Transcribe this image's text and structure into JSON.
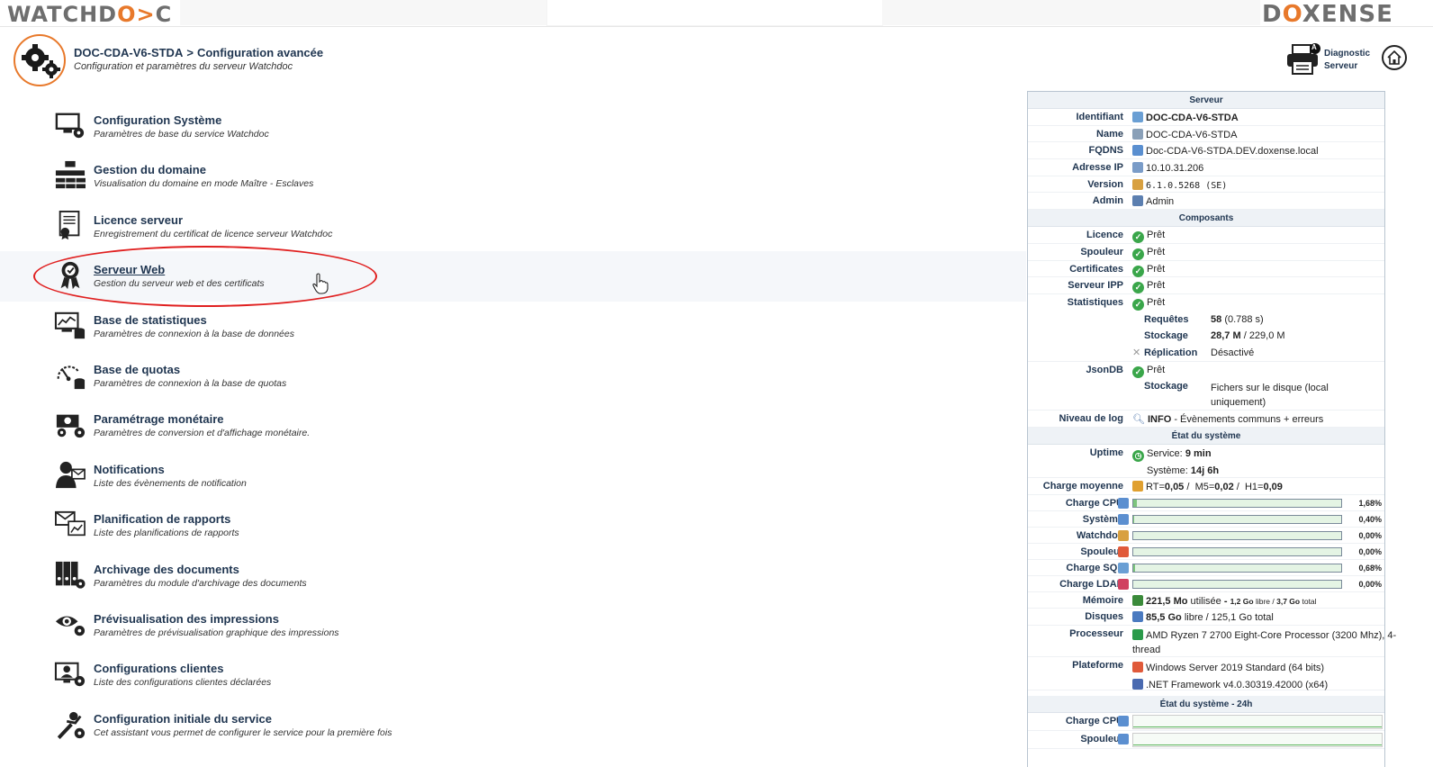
{
  "brand": {
    "left_prefix": "WATCHD",
    "left_mid": "O",
    "left_mid2": "C",
    "right_prefix": "D",
    "right_mid": "O",
    "right_suffix": "XENSE"
  },
  "header": {
    "server_name": "DOC-CDA-V6-STDA",
    "separator": ">",
    "page_title": "Configuration avancée",
    "subtitle": "Configuration et paramètres du serveur Watchdoc",
    "diag_line1": "Diagnostic",
    "diag_line2": "Serveur",
    "diag_badge": "A"
  },
  "menu": [
    {
      "title": "Configuration Système",
      "desc": "Paramètres de base du service Watchdoc",
      "icon": "monitor-gear-icon"
    },
    {
      "title": "Gestion du domaine",
      "desc": "Visualisation du domaine en mode Maître - Esclaves",
      "icon": "domain-servers-icon"
    },
    {
      "title": "Licence serveur",
      "desc": "Enregistrement du certificat de licence serveur Watchdoc",
      "icon": "certificate-icon"
    },
    {
      "title": "Serveur Web",
      "desc": "Gestion du serveur web et des certificats",
      "icon": "award-ribbon-icon"
    },
    {
      "title": "Base de statistiques",
      "desc": "Paramètres de connexion à la base de données",
      "icon": "stats-database-icon"
    },
    {
      "title": "Base de quotas",
      "desc": "Paramètres de connexion à la base de quotas",
      "icon": "quota-gauge-icon"
    },
    {
      "title": "Paramétrage monétaire",
      "desc": "Paramètres de conversion et d'affichage monétaire.",
      "icon": "money-gear-icon"
    },
    {
      "title": "Notifications",
      "desc": "Liste des évènements de notification",
      "icon": "user-mail-icon"
    },
    {
      "title": "Planification de rapports",
      "desc": "Liste des planifications de rapports",
      "icon": "mail-chart-icon"
    },
    {
      "title": "Archivage des documents",
      "desc": "Paramètres du module d'archivage des documents",
      "icon": "archive-binders-icon"
    },
    {
      "title": "Prévisualisation des impressions",
      "desc": "Paramètres de prévisualisation graphique des impressions",
      "icon": "eye-gear-icon"
    },
    {
      "title": "Configurations clientes",
      "desc": "Liste des configurations clientes déclarées",
      "icon": "client-config-icon"
    },
    {
      "title": "Configuration initiale du service",
      "desc": "Cet assistant vous permet de configurer le service pour la première fois",
      "icon": "wizard-icon"
    }
  ],
  "panel": {
    "sec_server": "Serveur",
    "server": [
      {
        "k": "Identifiant",
        "v": "DOC-CDA-V6-STDA",
        "bold": true,
        "c": "#6a9fd4"
      },
      {
        "k": "Name",
        "v": "DOC-CDA-V6-STDA",
        "bold": false,
        "c": "#8aa0b8"
      },
      {
        "k": "FQDNS",
        "v": "Doc-CDA-V6-STDA.DEV.doxense.local",
        "bold": false,
        "c": "#5a8fd0"
      },
      {
        "k": "Adresse IP",
        "v": "10.10.31.206",
        "bold": false,
        "c": "#7a9cc8"
      },
      {
        "k": "Version",
        "v": "6.1.0.5268 (SE)",
        "bold": false,
        "c": "#d8a040"
      },
      {
        "k": "Admin",
        "v": "Admin",
        "bold": false,
        "c": "#5c7fb0"
      }
    ],
    "sec_components": "Composants",
    "ready": "Prêt",
    "components": [
      "Licence",
      "Spouleur",
      "Certificates",
      "Serveur IPP",
      "Statistiques"
    ],
    "stats": {
      "req_label": "Requêtes",
      "req_value": "58",
      "req_extra": "(0.788 s)",
      "sto_label": "Stockage",
      "sto_value": "28,7 M",
      "sto_extra": "/ 229,0 M",
      "rep_label": "Réplication",
      "rep_value": "Désactivé"
    },
    "jsondb": {
      "k": "JsonDB",
      "sto_label": "Stockage",
      "sto_line1": "Fichers sur le disque (local",
      "sto_line2": "uniquement)"
    },
    "log": {
      "k": "Niveau de log",
      "level": "INFO",
      "desc": "- Évènements communs + erreurs"
    },
    "sec_state": "État du système",
    "uptime": {
      "k": "Uptime",
      "svc_label": "Service:",
      "svc_value": "9 min",
      "sys_label": "Système:",
      "sys_value": "14j 6h"
    },
    "load": {
      "k": "Charge moyenne",
      "rt_label": "RT=",
      "rt": "0,05",
      "m5_label": "M5=",
      "m5": "0,02",
      "h1_label": "H1=",
      "h1": "0,09",
      "slash": "/"
    },
    "bars": [
      {
        "k": "Charge CPU",
        "pct": "1,68%",
        "frac": 0.0168,
        "c": "#5b8fd0"
      },
      {
        "k": "Système",
        "pct": "0,40%",
        "frac": 0.004,
        "c": "#5b8fd0"
      },
      {
        "k": "Watchdoc",
        "pct": "0,00%",
        "frac": 0.0,
        "c": "#d8a040"
      },
      {
        "k": "Spouleur",
        "pct": "0,00%",
        "frac": 0.0,
        "c": "#e05a3a"
      },
      {
        "k": "Charge SQL",
        "pct": "0,68%",
        "frac": 0.0068,
        "c": "#6a9fd4"
      },
      {
        "k": "Charge LDAP",
        "pct": "0,00%",
        "frac": 0.0,
        "c": "#d04060"
      }
    ],
    "memory": {
      "k": "Mémoire",
      "used": "221,5 Mo",
      "used_lbl": "utilisée",
      "dash": "-",
      "free": "1,2 Go",
      "free_lbl": "libre",
      "total": "3,7 Go",
      "total_lbl": "total",
      "slash": "/"
    },
    "disks": {
      "k": "Disques",
      "free": "85,5 Go",
      "rest": "libre / 125,1 Go total"
    },
    "cpu": {
      "k": "Processeur",
      "line1": "AMD Ryzen 7 2700 Eight-Core Processor (3200 Mhz), 4-",
      "line2": "thread"
    },
    "platform": {
      "k": "Plateforme",
      "os": "Windows Server 2019 Standard (64 bits)",
      "net": ".NET Framework v4.0.30319.42000 (x64)"
    },
    "sec_24h": "État du système - 24h",
    "h24": [
      {
        "k": "Charge CPU"
      },
      {
        "k": "Spouleur"
      }
    ]
  }
}
